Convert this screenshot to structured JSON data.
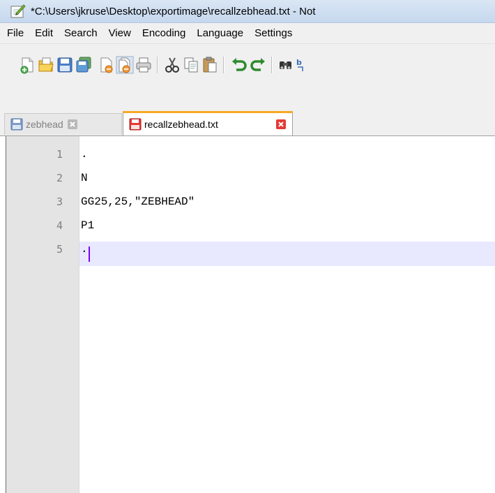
{
  "window": {
    "title": "*C:\\Users\\jkruse\\Desktop\\exportimage\\recallzebhead.txt - Not"
  },
  "menu": {
    "items": [
      "File",
      "Edit",
      "Search",
      "View",
      "Encoding",
      "Language",
      "Settings"
    ]
  },
  "toolbar": {
    "buttons": [
      "new-file-icon",
      "open-file-icon",
      "save-icon",
      "save-all-icon",
      "close-icon",
      "close-all-icon",
      "print-icon",
      "cut-icon",
      "copy-icon",
      "paste-icon",
      "undo-icon",
      "redo-icon",
      "find-icon",
      "replace-icon"
    ]
  },
  "tabs": [
    {
      "label": "zebhead",
      "active": false
    },
    {
      "label": "recallzebhead.txt",
      "active": true
    }
  ],
  "editor": {
    "line_numbers": [
      "1",
      "2",
      "3",
      "4",
      "5"
    ],
    "lines": [
      ".",
      "N",
      "GG25,25,\"ZEBHEAD\"",
      "P1",
      "."
    ],
    "current_line": 5,
    "colors": {
      "gutter": "#e4e4e4",
      "current_line": "#e8e8ff",
      "caret": "#8000ff",
      "active_tab_accent": "#f9a825"
    }
  }
}
